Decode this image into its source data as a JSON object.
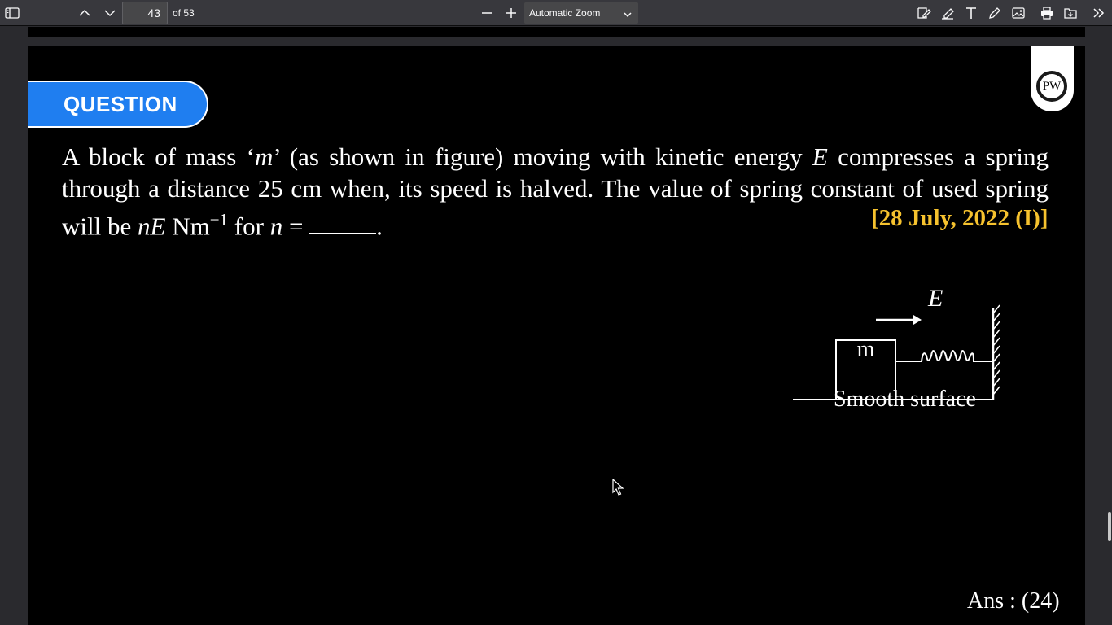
{
  "toolbar": {
    "page_number": "43",
    "page_count": "of 53",
    "zoom_value": "Automatic Zoom"
  },
  "slide": {
    "badge": "QUESTION",
    "logo_text": "PW",
    "question_parts": {
      "p1": "A block of mass ‘",
      "m": "m",
      "p2": "’ (as shown in figure) moving with kinetic energy ",
      "E": "E",
      "p3": " compresses a spring through a distance 25 cm when, its speed is halved. The value of spring constant of used spring will be ",
      "nE": "nE",
      "p4": " Nm",
      "sup": "−1",
      "p5": " for ",
      "n": "n",
      "p6": " = ",
      "p7": "."
    },
    "date_tag": "[28 July, 2022 (I)]",
    "figure": {
      "arrow_label": "E",
      "block_label": "m",
      "caption": "Smooth surface"
    },
    "answer": "Ans : (24)"
  }
}
